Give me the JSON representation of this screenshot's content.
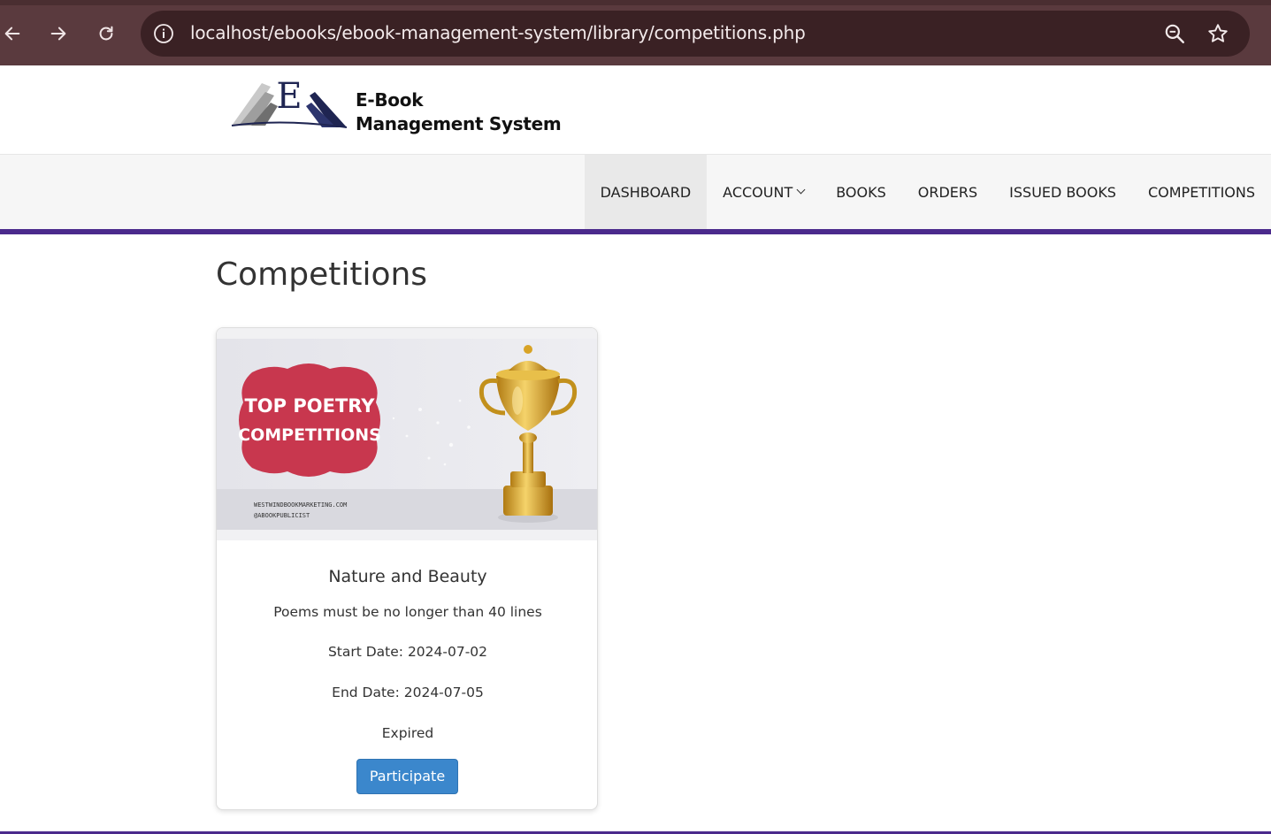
{
  "browser": {
    "url": "localhost/ebooks/ebook-management-system/library/competitions.php"
  },
  "site": {
    "logo_letter": "E",
    "logo_line1": "E-Book",
    "logo_line2": "Management System"
  },
  "nav": {
    "items": [
      {
        "label": "DASHBOARD"
      },
      {
        "label": "ACCOUNT"
      },
      {
        "label": "BOOKS"
      },
      {
        "label": "ORDERS"
      },
      {
        "label": "ISSUED BOOKS"
      },
      {
        "label": "COMPETITIONS"
      }
    ]
  },
  "page": {
    "title": "Competitions"
  },
  "competitions": [
    {
      "banner_line1": "TOP POETRY",
      "banner_line2": "COMPETITIONS",
      "banner_site": "WESTWINDBOOKMARKETING.COM",
      "banner_handle": "@ABOOKPUBLICIST",
      "title": "Nature and Beauty",
      "description": "Poems must be no longer than 40 lines",
      "start_date": "Start Date: 2024-07-02",
      "end_date": "End Date: 2024-07-05",
      "status": "Expired",
      "button_label": "Participate"
    }
  ],
  "colors": {
    "nav_accent": "#4b2a8c",
    "button": "#3b87cc",
    "banner_red": "#c8374e",
    "trophy_gold": "#d8a326"
  }
}
